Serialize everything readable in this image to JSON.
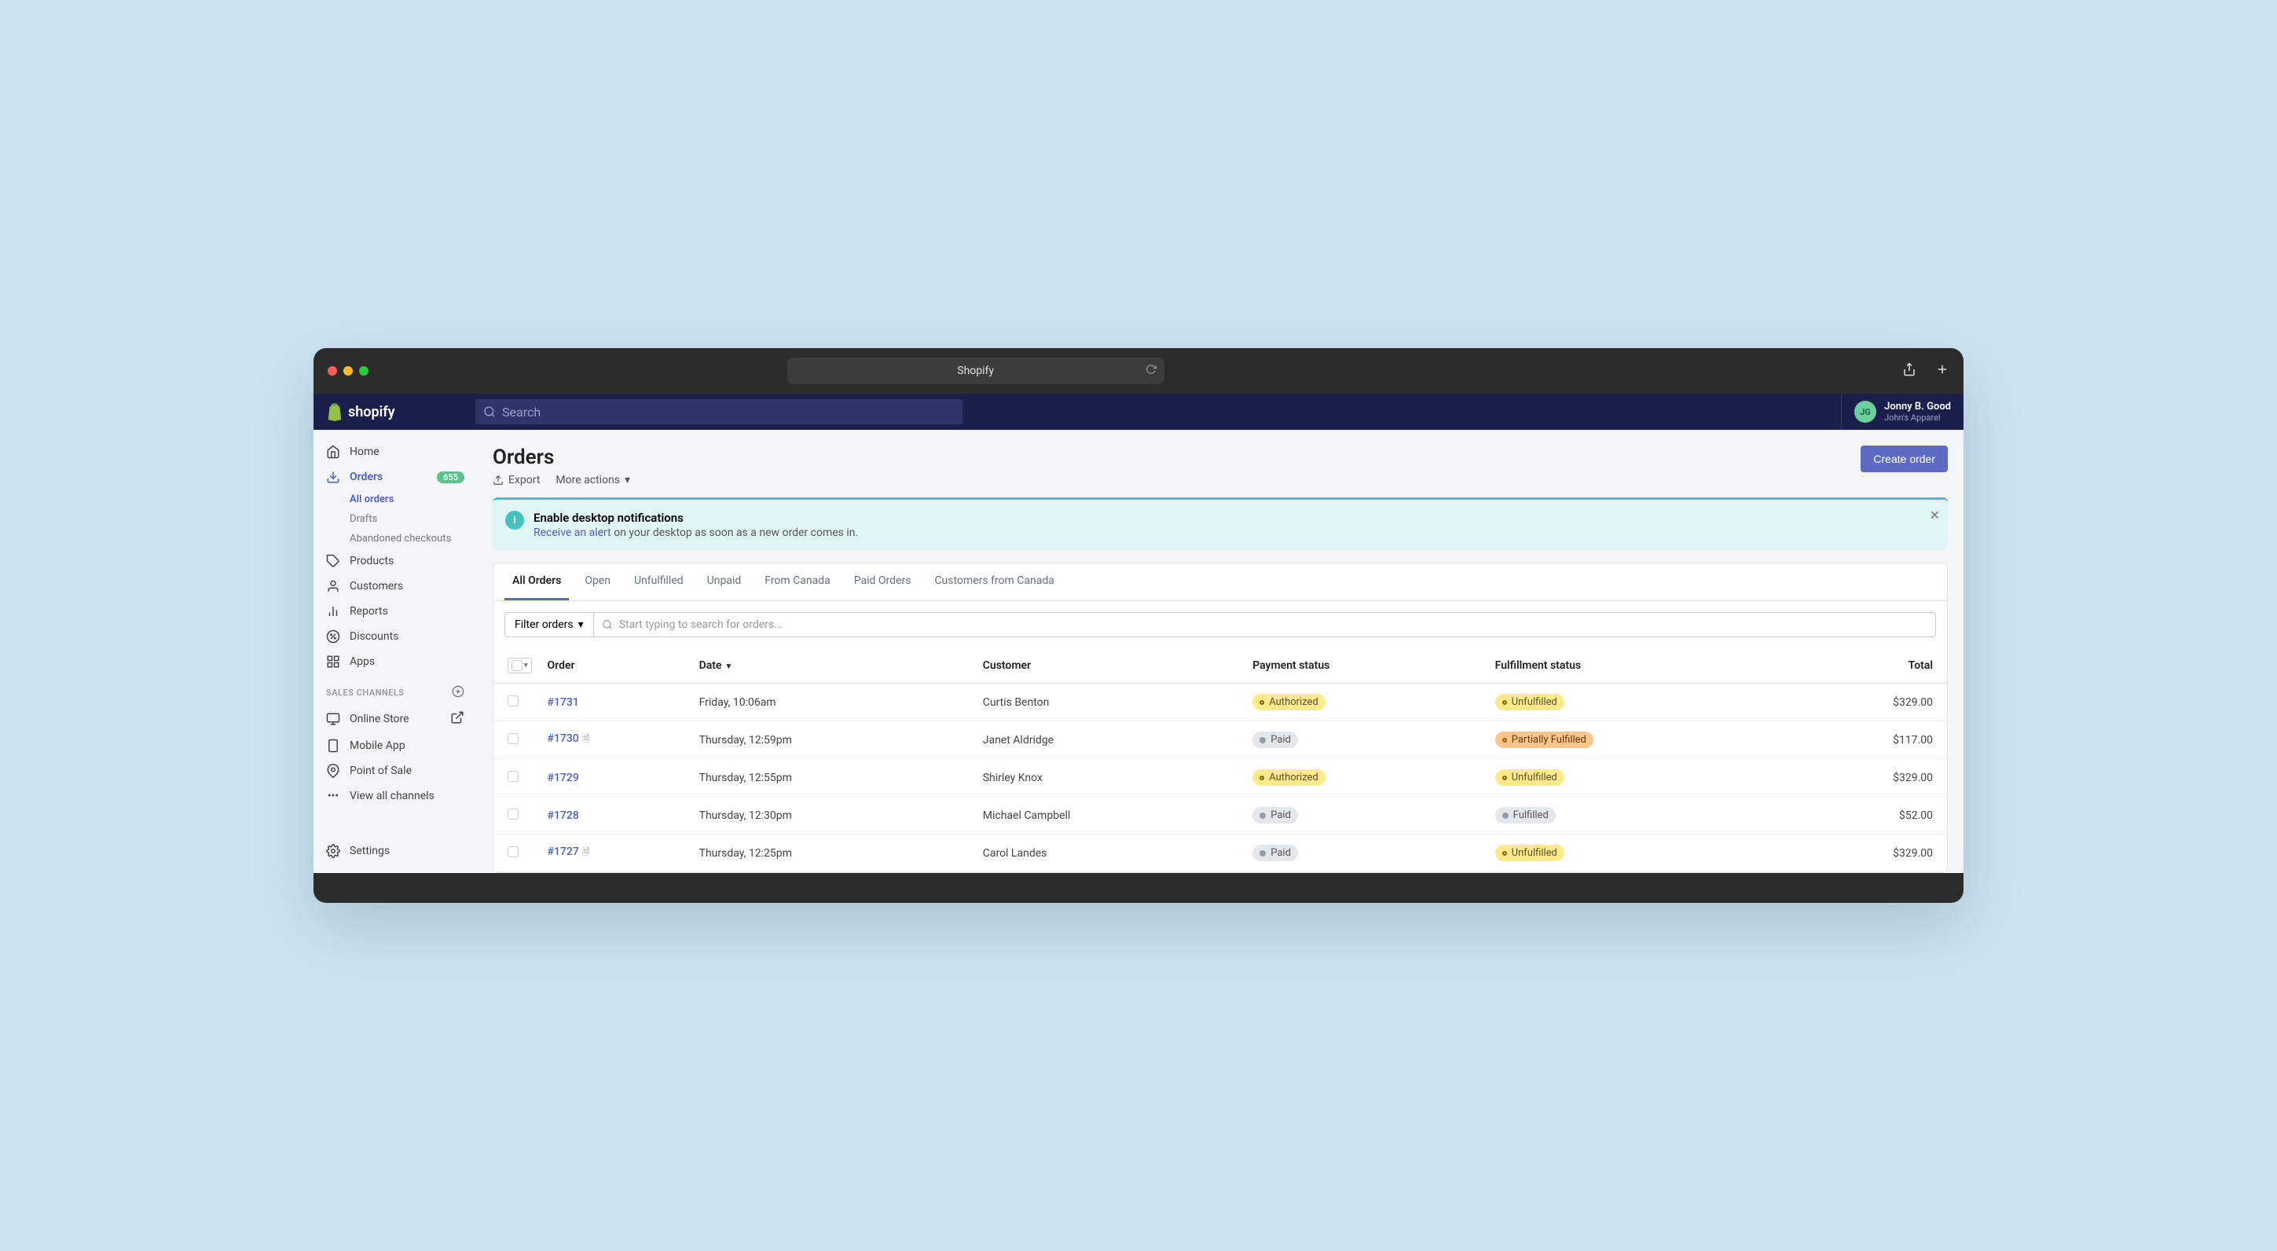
{
  "browser": {
    "url_label": "Shopify"
  },
  "header": {
    "brand": "shopify",
    "search_placeholder": "Search",
    "user": {
      "initials": "JG",
      "name": "Jonny B. Good",
      "store": "John's Apparel"
    }
  },
  "sidebar": {
    "items": [
      {
        "icon": "home",
        "label": "Home"
      },
      {
        "icon": "orders",
        "label": "Orders",
        "badge": "655",
        "active": true,
        "sub": [
          {
            "label": "All orders",
            "active": true
          },
          {
            "label": "Drafts"
          },
          {
            "label": "Abandoned checkouts"
          }
        ]
      },
      {
        "icon": "products",
        "label": "Products"
      },
      {
        "icon": "customers",
        "label": "Customers"
      },
      {
        "icon": "reports",
        "label": "Reports"
      },
      {
        "icon": "discounts",
        "label": "Discounts"
      },
      {
        "icon": "apps",
        "label": "Apps"
      }
    ],
    "section_label": "SALES CHANNELS",
    "channels": [
      {
        "icon": "online-store",
        "label": "Online Store",
        "external": true
      },
      {
        "icon": "mobile",
        "label": "Mobile App"
      },
      {
        "icon": "pos",
        "label": "Point of Sale"
      }
    ],
    "view_all": "View all channels",
    "settings": "Settings"
  },
  "page": {
    "title": "Orders",
    "export": "Export",
    "more_actions": "More actions",
    "create_button": "Create order"
  },
  "banner": {
    "title": "Enable desktop notifications",
    "link": "Receive an alert",
    "body_rest": " on your desktop as soon as a new order comes in."
  },
  "tabs": [
    "All Orders",
    "Open",
    "Unfulfilled",
    "Unpaid",
    "From Canada",
    "Paid Orders",
    "Customers from Canada"
  ],
  "filter": {
    "button": "Filter orders",
    "search_placeholder": "Start typing to search for orders..."
  },
  "columns": {
    "order": "Order",
    "date": "Date",
    "customer": "Customer",
    "payment": "Payment status",
    "fulfillment": "Fulfillment status",
    "total": "Total"
  },
  "rows": [
    {
      "order": "#1731",
      "note": false,
      "date": "Friday, 10:06am",
      "customer": "Curtis Benton",
      "payment": {
        "label": "Authorized",
        "variant": "yellow"
      },
      "fulfillment": {
        "label": "Unfulfilled",
        "variant": "yellow"
      },
      "total": "$329.00"
    },
    {
      "order": "#1730",
      "note": true,
      "date": "Thursday, 12:59pm",
      "customer": "Janet Aldridge",
      "payment": {
        "label": "Paid",
        "variant": "gray"
      },
      "fulfillment": {
        "label": "Partially Fulfilled",
        "variant": "orange"
      },
      "total": "$117.00"
    },
    {
      "order": "#1729",
      "note": false,
      "date": "Thursday, 12:55pm",
      "customer": "Shirley Knox",
      "payment": {
        "label": "Authorized",
        "variant": "yellow"
      },
      "fulfillment": {
        "label": "Unfulfilled",
        "variant": "yellow"
      },
      "total": "$329.00"
    },
    {
      "order": "#1728",
      "note": false,
      "date": "Thursday, 12:30pm",
      "customer": "Michael Campbell",
      "payment": {
        "label": "Paid",
        "variant": "gray"
      },
      "fulfillment": {
        "label": "Fulfilled",
        "variant": "gray"
      },
      "total": "$52.00"
    },
    {
      "order": "#1727",
      "note": true,
      "date": "Thursday, 12:25pm",
      "customer": "Carol Landes",
      "payment": {
        "label": "Paid",
        "variant": "gray"
      },
      "fulfillment": {
        "label": "Unfulfilled",
        "variant": "yellow"
      },
      "total": "$329.00"
    }
  ]
}
